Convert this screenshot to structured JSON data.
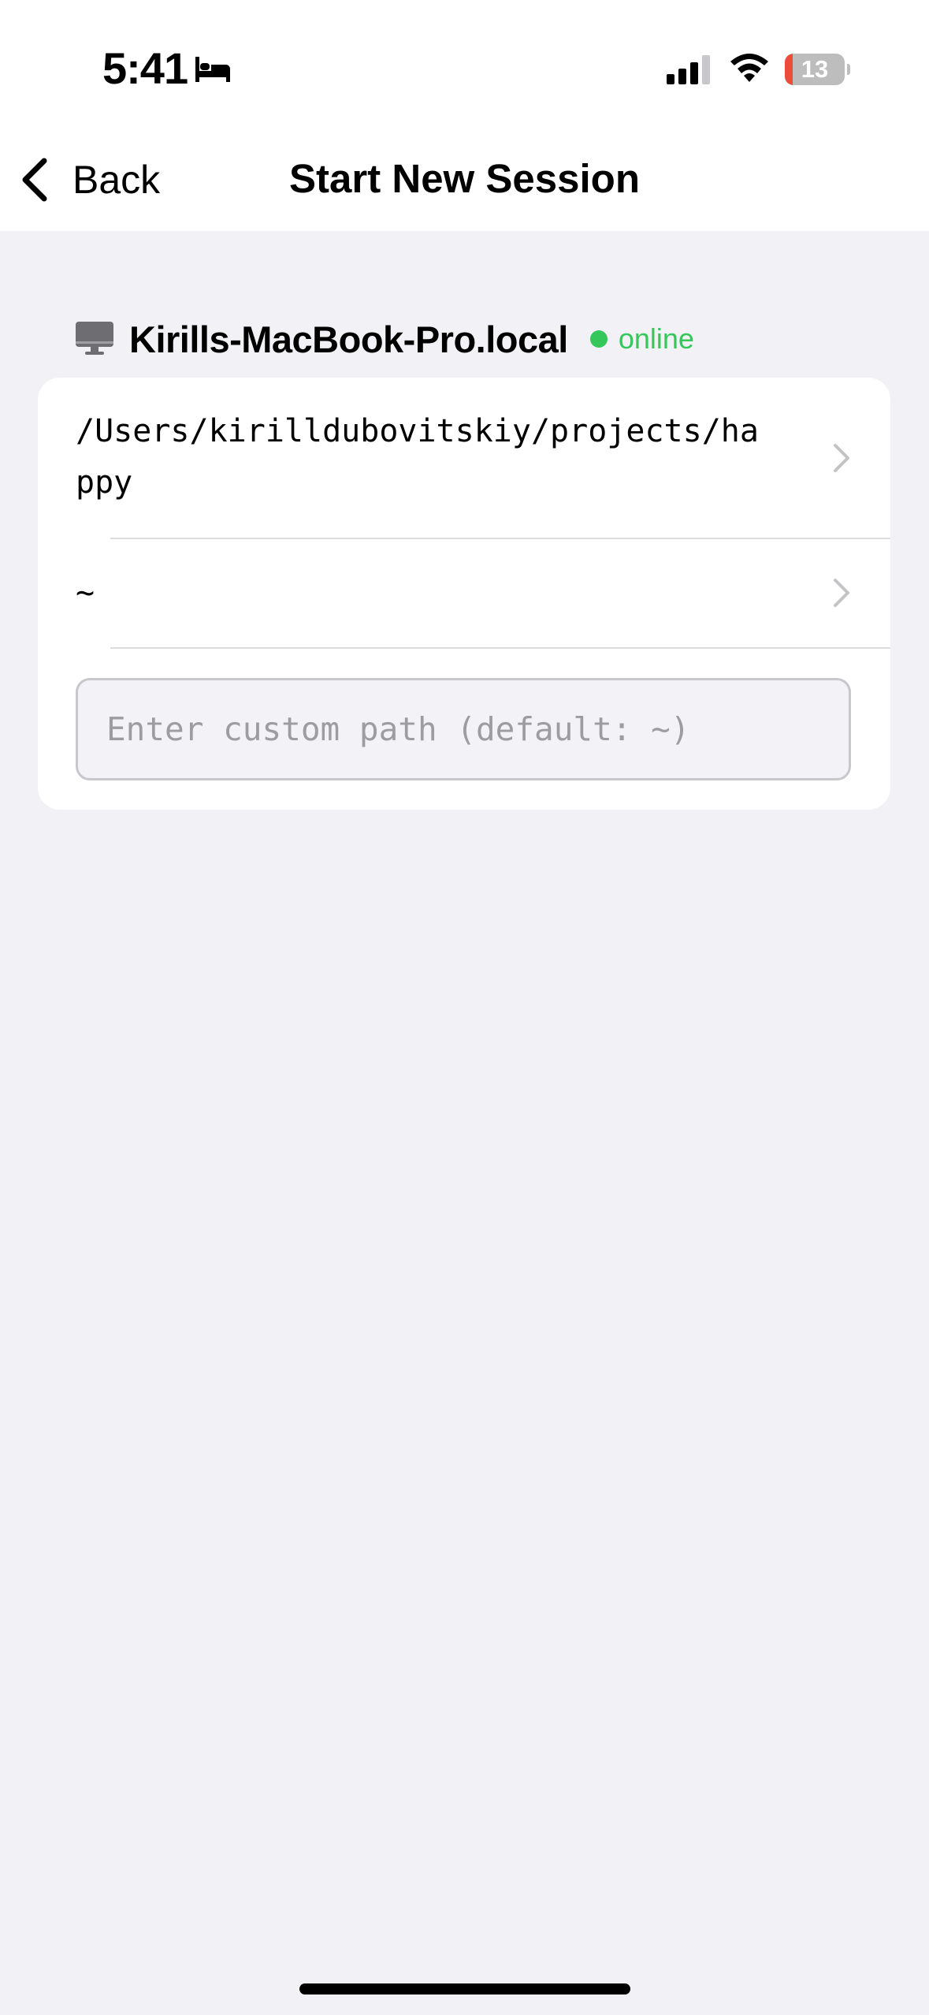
{
  "status_bar": {
    "time": "5:41",
    "sleep_icon": "bed-icon",
    "signal_icon": "cellular-signal-icon",
    "wifi_icon": "wifi-icon",
    "battery_level": "13",
    "battery_fraction": 0.13,
    "battery_color": "#eb4d3d"
  },
  "nav": {
    "back_label": "Back",
    "back_icon": "chevron-left-icon",
    "title": "Start New Session"
  },
  "machine": {
    "icon": "desktop-computer-icon",
    "name": "Kirills-MacBook-Pro.local",
    "status": "online",
    "status_color": "#35c759"
  },
  "paths": [
    {
      "path": "/Users/kirilldubovitskiy/projects/happy",
      "icon": "chevron-right-icon"
    },
    {
      "path": "~",
      "icon": "chevron-right-icon"
    }
  ],
  "custom_path": {
    "value": "",
    "placeholder": "Enter custom path (default: ~)"
  },
  "colors": {
    "background": "#f2f1f6",
    "card": "#ffffff",
    "chevron": "#c4c4c7"
  }
}
